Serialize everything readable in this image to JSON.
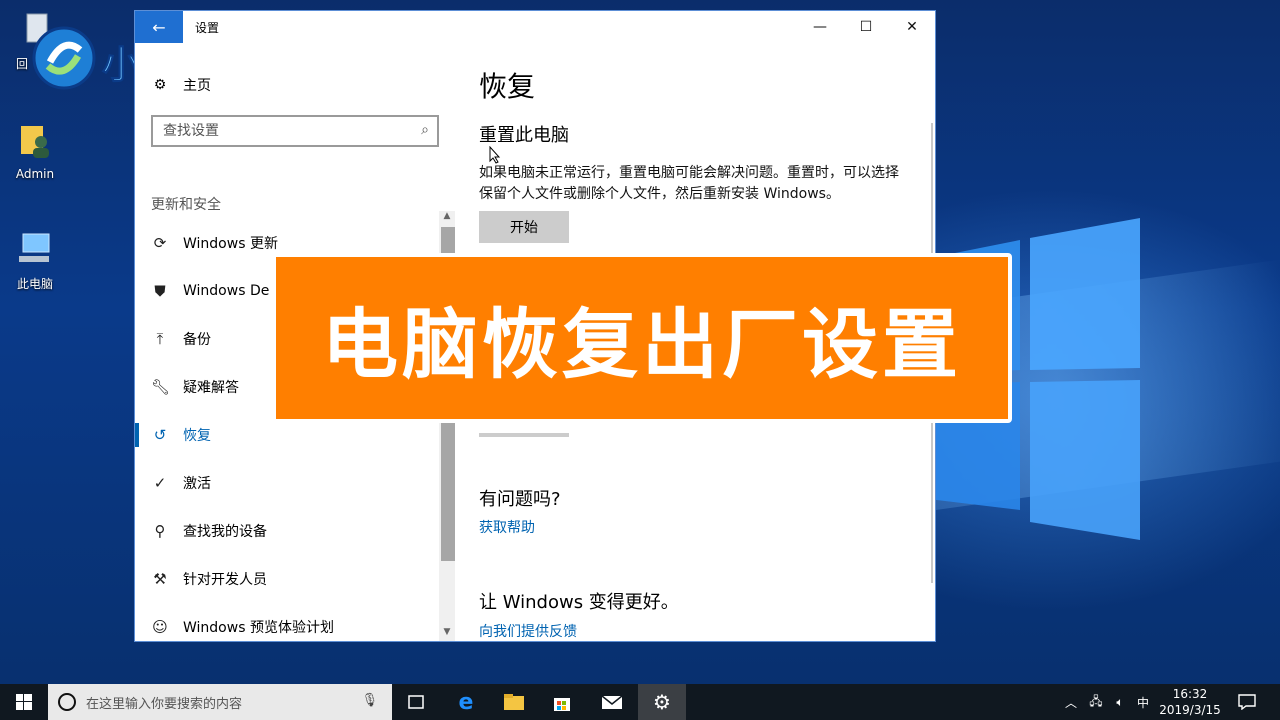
{
  "desktop": {
    "icons": [
      {
        "label": "回"
      },
      {
        "label": "Admin"
      },
      {
        "label": "此电脑"
      }
    ]
  },
  "brand": {
    "text": "小白系统"
  },
  "window": {
    "title": "设置",
    "controls": {
      "minimize": "—",
      "maximize": "☐",
      "close": "✕"
    }
  },
  "nav": {
    "home": "主页",
    "search_placeholder": "查找设置",
    "section": "更新和安全",
    "items": [
      {
        "label": "Windows 更新",
        "icon": "sync-icon"
      },
      {
        "label": "Windows De",
        "icon": "shield-icon"
      },
      {
        "label": "备份",
        "icon": "upload-icon"
      },
      {
        "label": "疑难解答",
        "icon": "wrench-icon"
      },
      {
        "label": "恢复",
        "icon": "history-icon",
        "active": true
      },
      {
        "label": "激活",
        "icon": "check-circle-icon"
      },
      {
        "label": "查找我的设备",
        "icon": "person-pin-icon"
      },
      {
        "label": "针对开发人员",
        "icon": "tools-icon"
      },
      {
        "label": "Windows 预览体验计划",
        "icon": "user-icon"
      }
    ]
  },
  "content": {
    "title": "恢复",
    "reset": {
      "heading": "重置此电脑",
      "description": "如果电脑未正常运行，重置电脑可能会解决问题。重置时，可以选择保留个人文件或删除个人文件，然后重新安装 Windows。",
      "button": "开始"
    },
    "help": {
      "heading": "有问题吗?",
      "link": "获取帮助"
    },
    "feedback": {
      "heading": "让 Windows 变得更好。",
      "link": "向我们提供反馈"
    }
  },
  "banner": {
    "text": "电脑恢复出厂设置"
  },
  "taskbar": {
    "search_placeholder": "在这里输入你要搜索的内容",
    "ime": "中",
    "time": "16:32",
    "date": "2019/3/15"
  },
  "colors": {
    "accent": "#0063b1",
    "banner": "#ff7f00",
    "taskbar": "#101820"
  }
}
